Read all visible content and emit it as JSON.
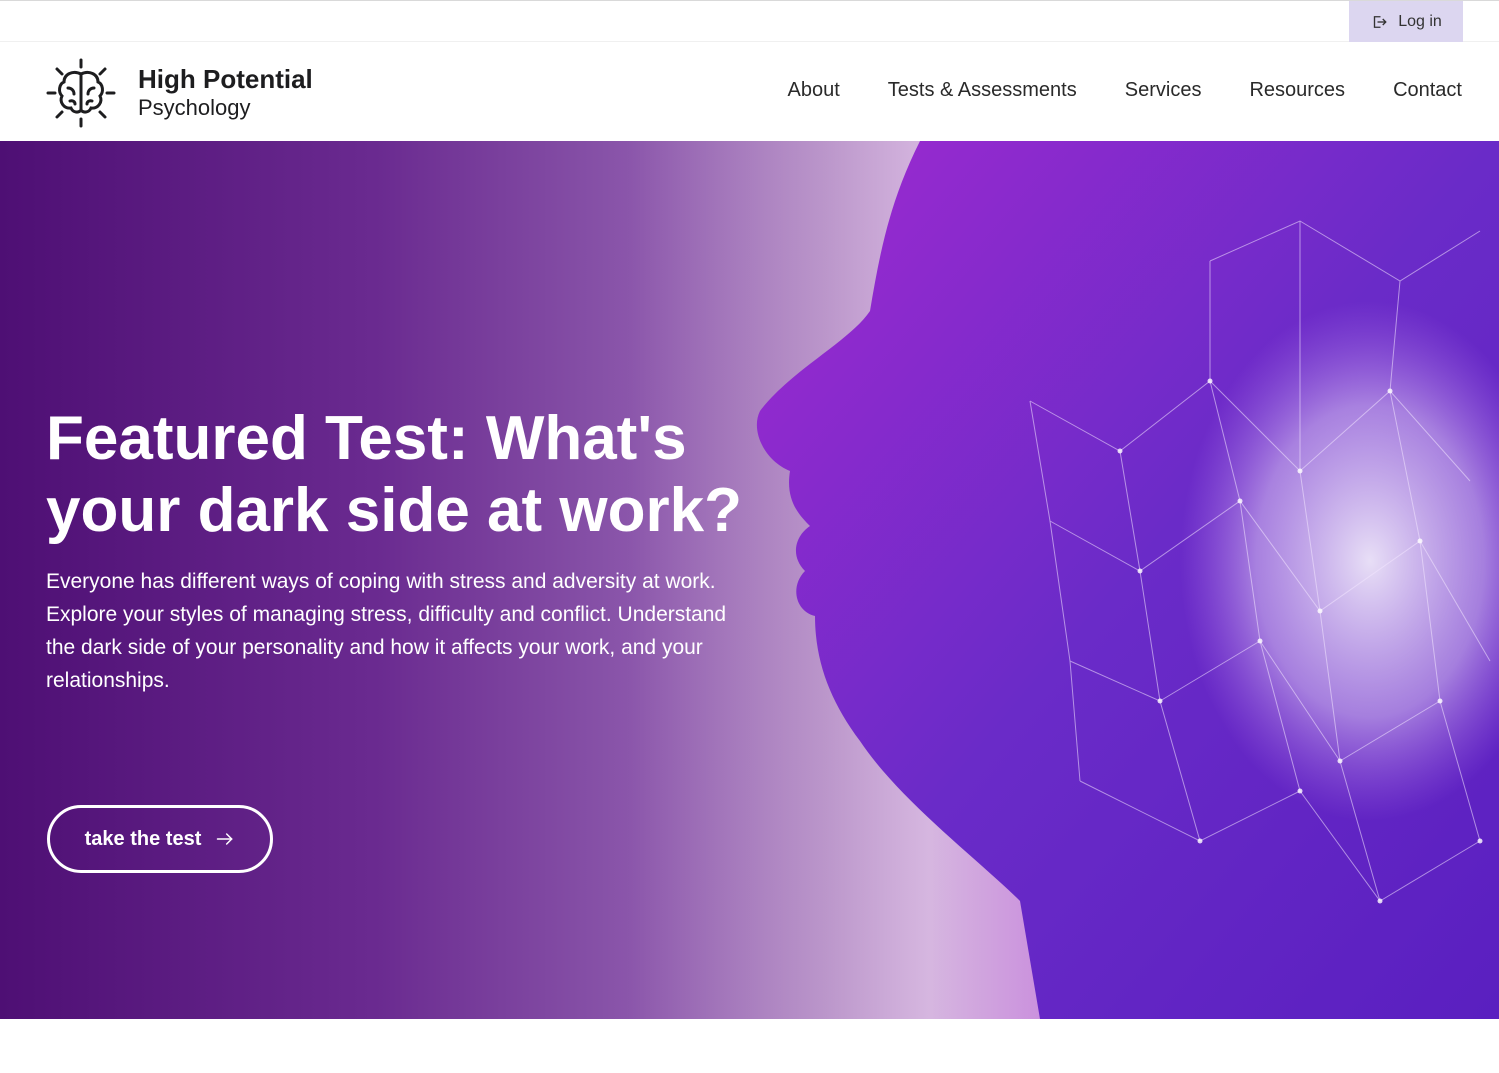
{
  "topbar": {
    "login_label": "Log in",
    "login_icon": "login-icon"
  },
  "header": {
    "logo_title": "High Potential",
    "logo_subtitle": "Psychology",
    "logo_icon": "brain-icon",
    "nav": [
      "About",
      "Tests & Assessments",
      "Services",
      "Resources",
      "Contact"
    ]
  },
  "hero": {
    "title": "Featured Test: What's your dark side at work?",
    "description": "Everyone has different ways of coping with stress and adversity at work. Explore your styles of managing stress, difficulty and conflict. Understand the dark side of your personality and how it affects your work, and your relationships.",
    "cta_label": "take the test",
    "cta_icon": "arrow-right-icon",
    "image": "woman-profile-with-digital-brain-image"
  },
  "colors": {
    "accent_dark": "#4e0f74",
    "accent_light": "#8b5ad8",
    "login_bg": "#dcd6f0"
  }
}
